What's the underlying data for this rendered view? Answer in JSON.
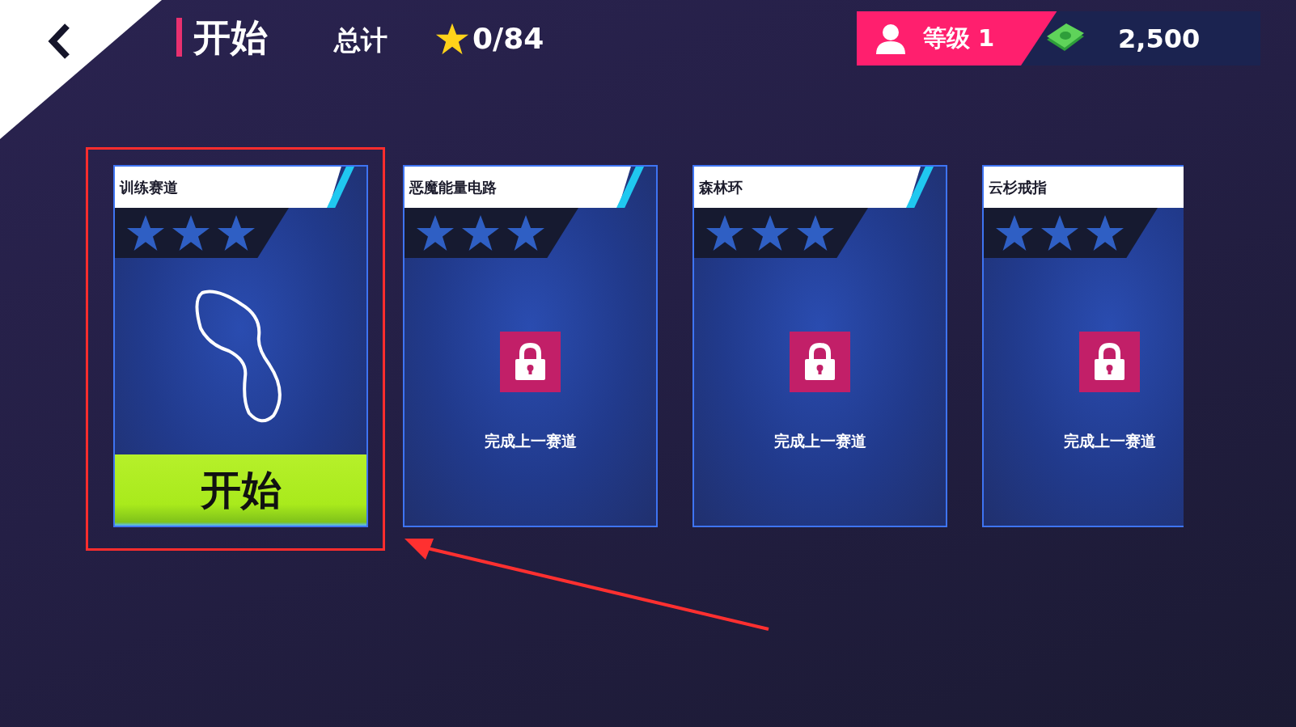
{
  "header": {
    "title": "开始",
    "total_label": "总计",
    "star_count": "0/84",
    "level": "等级 1",
    "money": "2,500"
  },
  "cards": [
    {
      "title": "训练赛道",
      "locked": false,
      "highlighted": true,
      "button": "开始"
    },
    {
      "title": "恶魔能量电路",
      "locked": true,
      "highlighted": false,
      "hint": "完成上一赛道"
    },
    {
      "title": "森林环",
      "locked": true,
      "highlighted": false,
      "hint": "完成上一赛道"
    },
    {
      "title": "云杉戒指",
      "locked": true,
      "highlighted": false,
      "hint": "完成上一赛道"
    }
  ]
}
